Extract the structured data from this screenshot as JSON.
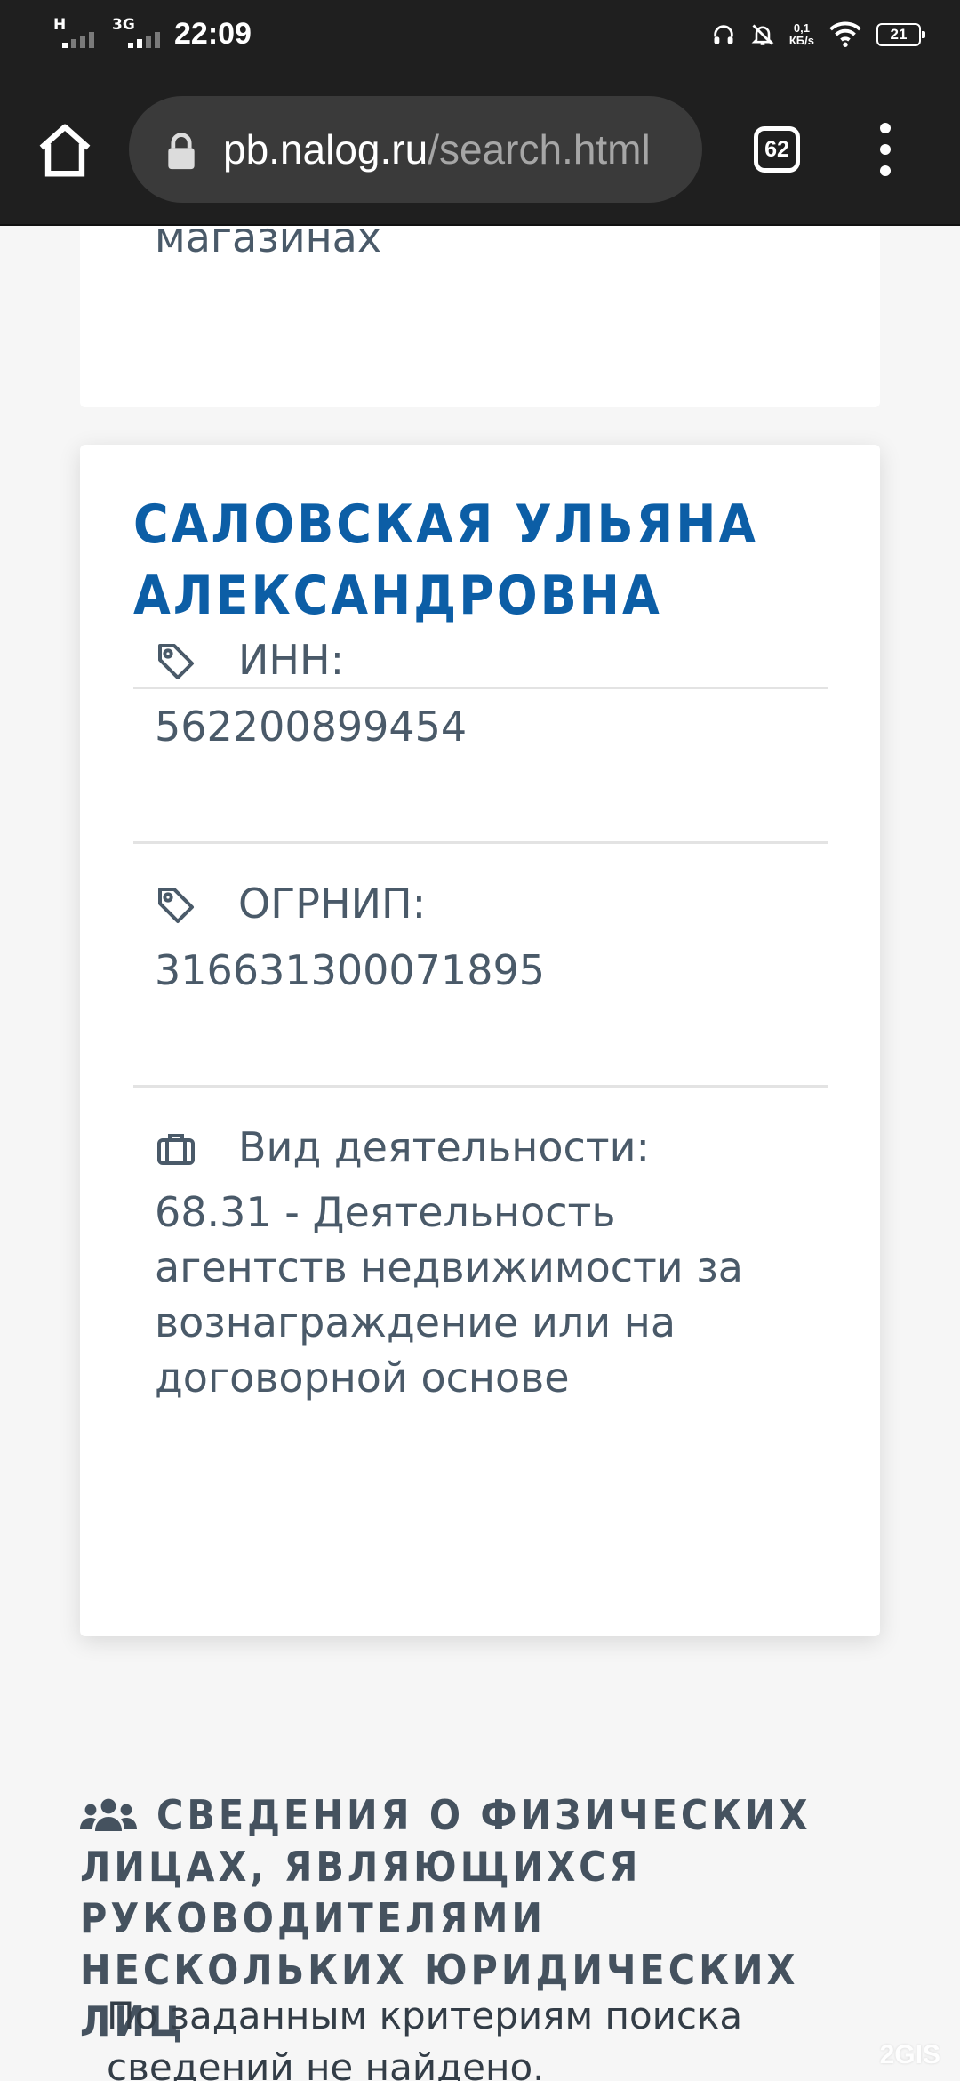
{
  "status_bar": {
    "signal_1_label": "H",
    "signal_2_label": "3G",
    "time": "22:09",
    "net_speed_value": "0,1",
    "net_speed_unit": "КБ/s",
    "battery": "21"
  },
  "browser": {
    "url_host": "pb.nalog.ru",
    "url_path": "/search.html",
    "tab_count": "62"
  },
  "previous_card": {
    "text": "специализированных магазинах"
  },
  "entry": {
    "name": "САЛОВСКАЯ УЛЬЯНА АЛЕКСАНДРОВНА",
    "inn_label": "ИНН:",
    "inn_value": "562200899454",
    "ogrnip_label": "ОГРНИП:",
    "ogrnip_value": "316631300071895",
    "activity_label": "Вид деятельности:",
    "activity_value": "68.31 - Деятельность агентств недвижимости за вознаграждение или на договорной основе"
  },
  "section": {
    "title": "СВЕДЕНИЯ О ФИЗИЧЕСКИХ ЛИЦАХ, ЯВЛЯЮЩИХСЯ РУКОВОДИТЕЛЯМИ НЕСКОЛЬКИХ ЮРИДИЧЕСКИХ ЛИЦ",
    "empty_text": "По заданным критериям поиска сведений не найдено."
  },
  "watermark": "2GIS",
  "colors": {
    "title_blue": "#0c5ea6",
    "text_gray": "#4a5a69",
    "background": "#f6f6f6",
    "browser_bar": "#1f1f1f"
  },
  "icons": {
    "home": "home-icon",
    "lock": "lock-icon",
    "menu": "more-vertical-icon",
    "tag": "tag-icon",
    "briefcase": "briefcase-icon",
    "group": "users-icon"
  }
}
